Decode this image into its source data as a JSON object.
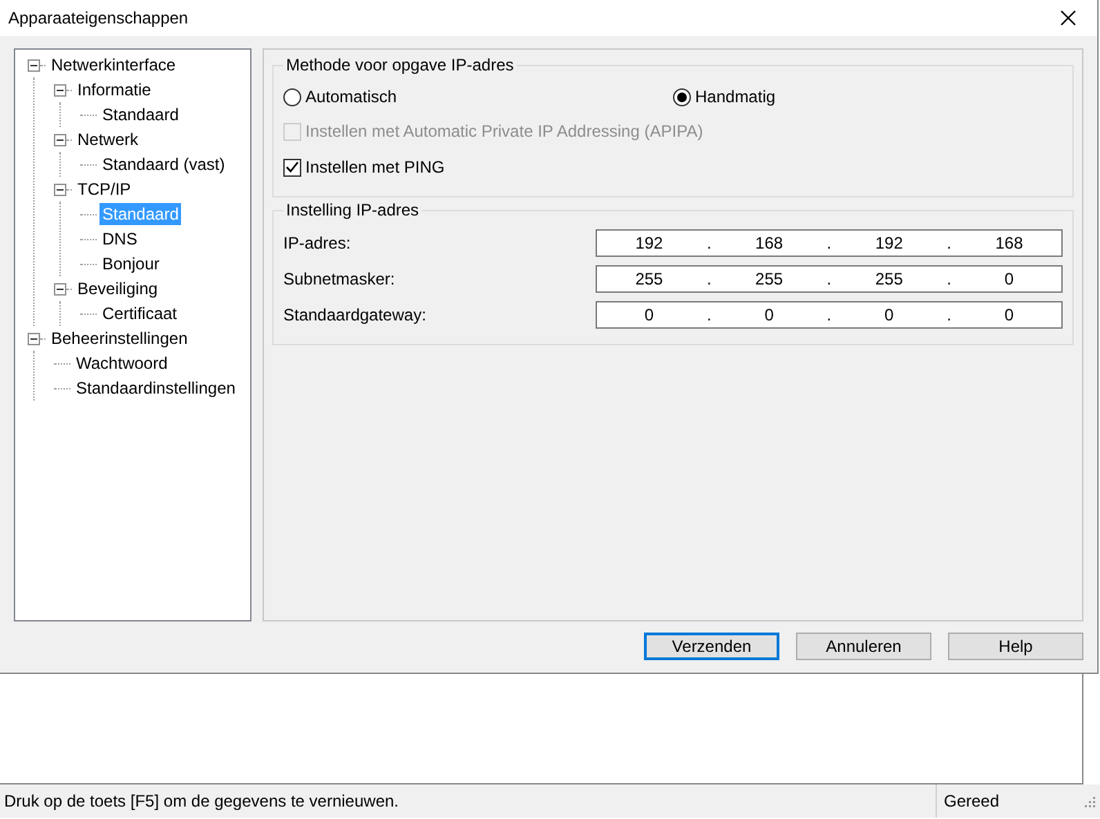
{
  "window": {
    "title": "Apparaateigenschappen"
  },
  "tree": [
    {
      "label": "Netwerkinterface",
      "expanded": true,
      "selected": false,
      "children": [
        {
          "label": "Informatie",
          "expanded": true,
          "selected": false,
          "children": [
            {
              "label": "Standaard",
              "selected": false
            }
          ]
        },
        {
          "label": "Netwerk",
          "expanded": true,
          "selected": false,
          "children": [
            {
              "label": "Standaard (vast)",
              "selected": false
            }
          ]
        },
        {
          "label": "TCP/IP",
          "expanded": true,
          "selected": false,
          "children": [
            {
              "label": "Standaard",
              "selected": true
            },
            {
              "label": "DNS",
              "selected": false
            },
            {
              "label": "Bonjour",
              "selected": false
            }
          ]
        },
        {
          "label": "Beveiliging",
          "expanded": true,
          "selected": false,
          "children": [
            {
              "label": "Certificaat",
              "selected": false
            }
          ]
        }
      ]
    },
    {
      "label": "Beheerinstellingen",
      "expanded": true,
      "selected": false,
      "children": [
        {
          "label": "Wachtwoord",
          "selected": false
        },
        {
          "label": "Standaardinstellingen",
          "selected": false
        }
      ]
    }
  ],
  "method_group": {
    "title": "Methode voor opgave IP-adres",
    "radios": [
      {
        "label": "Automatisch",
        "selected": false
      },
      {
        "label": "Handmatig",
        "selected": true
      }
    ],
    "checkboxes": [
      {
        "label": "Instellen met Automatic Private IP Addressing (APIPA)",
        "checked": false,
        "disabled": true
      },
      {
        "label": "Instellen met PING",
        "checked": true,
        "disabled": false
      }
    ]
  },
  "ip_group": {
    "title": "Instelling IP-adres",
    "fields": [
      {
        "label": "IP-adres:",
        "octets": [
          "192",
          "168",
          "192",
          "168"
        ],
        "separator": "."
      },
      {
        "label": "Subnetmasker:",
        "octets": [
          "255",
          "255",
          "255",
          "0"
        ],
        "separator": "."
      },
      {
        "label": "Standaardgateway:",
        "octets": [
          "0",
          "0",
          "0",
          "0"
        ],
        "separator": "."
      }
    ]
  },
  "buttons": [
    {
      "label": "Verzenden",
      "default": true
    },
    {
      "label": "Annuleren",
      "default": false
    },
    {
      "label": "Help",
      "default": false
    }
  ],
  "status_bar": {
    "message": "Druk op de toets [F5] om de gegevens te vernieuwen.",
    "state": "Gereed"
  }
}
